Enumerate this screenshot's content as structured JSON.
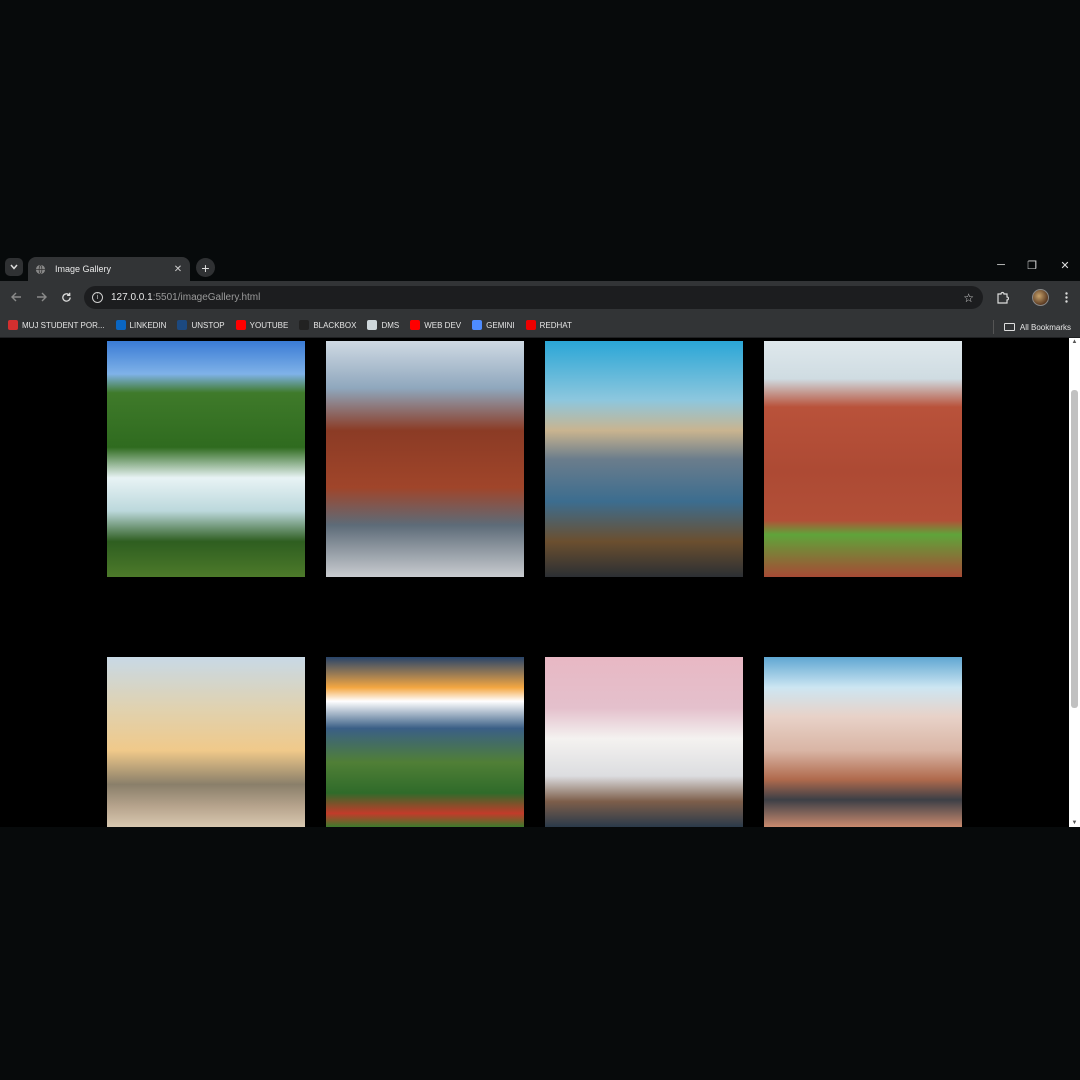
{
  "tab": {
    "title": "Image Gallery",
    "close": "✕",
    "new": "+"
  },
  "window": {
    "minimize": "─",
    "restore": "❐",
    "close": "✕"
  },
  "toolbar": {
    "url_host": "127.0.0.1",
    "url_rest": ":5501/imageGallery.html"
  },
  "bookmarks": [
    {
      "label": "MUJ STUDENT POR...",
      "icon": "muj-logo-icon",
      "color": "#d32f2f"
    },
    {
      "label": "LINKEDIN",
      "icon": "linkedin-icon",
      "color": "#0a66c2"
    },
    {
      "label": "UNSTOP",
      "icon": "unstop-icon",
      "color": "#1c4980"
    },
    {
      "label": "YOUTUBE",
      "icon": "youtube-icon",
      "color": "#ff0000"
    },
    {
      "label": "BLACKBOX",
      "icon": "blackbox-icon",
      "color": "#222222"
    },
    {
      "label": "DMS",
      "icon": "document-icon",
      "color": "#cfd8dc"
    },
    {
      "label": "WEB DEV",
      "icon": "youtube-icon",
      "color": "#ff0000"
    },
    {
      "label": "GEMINI",
      "icon": "gemini-sparkle-icon",
      "color": "#4e8cff"
    },
    {
      "label": "REDHAT",
      "icon": "redhat-icon",
      "color": "#ee0000"
    }
  ],
  "all_bookmarks": "All Bookmarks",
  "gallery": [
    {
      "subject": "waterfall-town",
      "bg": "linear-gradient(180deg,#3a7bd5 0%,#7fb2e8 14%,#3f7a2a 22%,#2f6b1f 45%,#e8f3f5 58%,#bcd8dc 72%,#2e5e20 85%,#4d7a2a 100%)"
    },
    {
      "subject": "city-street",
      "bg": "linear-gradient(180deg,#cfd9e3 0%,#8fa7bd 20%,#8b3b25 38%,#a0452a 62%,#5d6b78 78%,#c9ccd0 100%)"
    },
    {
      "subject": "london-eye-river",
      "bg": "linear-gradient(180deg,#2aa6d6 0%,#8dc7de 25%,#c9b48f 38%,#6b7d8c 50%,#3c6d8f 68%,#6b4f2f 85%,#2b2f33 100%)"
    },
    {
      "subject": "red-fort",
      "bg": "linear-gradient(180deg,#dfe8ec 0%,#cfdce2 16%,#b9523a 28%,#ad4a34 55%,#b24f37 76%,#5fa43a 82%,#a64a35 100%)"
    },
    {
      "subject": "istanbul-mosque",
      "bg": "linear-gradient(180deg,#c8d9e6 0%,#e0d2b0 30%,#f0c98a 55%,#8a7f6a 75%,#b7a48d 88%,#d8c8b0 100%)"
    },
    {
      "subject": "mountain-train",
      "bg": "linear-gradient(180deg,#28446a 0%,#f4a742 18%,#ffffff 26%,#3a5f86 42%,#507f36 62%,#2f6b2a 80%,#c23b2a 92%,#3c7a2c 100%)"
    },
    {
      "subject": "lotus-temple",
      "bg": "linear-gradient(180deg,#e8b8c4 0%,#e4c0cc 30%,#f4f2f0 48%,#dcdde0 70%,#7d5e4a 85%,#2a3a4a 100%)"
    },
    {
      "subject": "taj-mahal",
      "bg": "linear-gradient(180deg,#5fa7d2 0%,#cde6f2 18%,#e8d2c8 35%,#d9b5a5 55%,#b06a4d 72%,#3c3f46 84%,#c98a6e 100%)"
    }
  ]
}
